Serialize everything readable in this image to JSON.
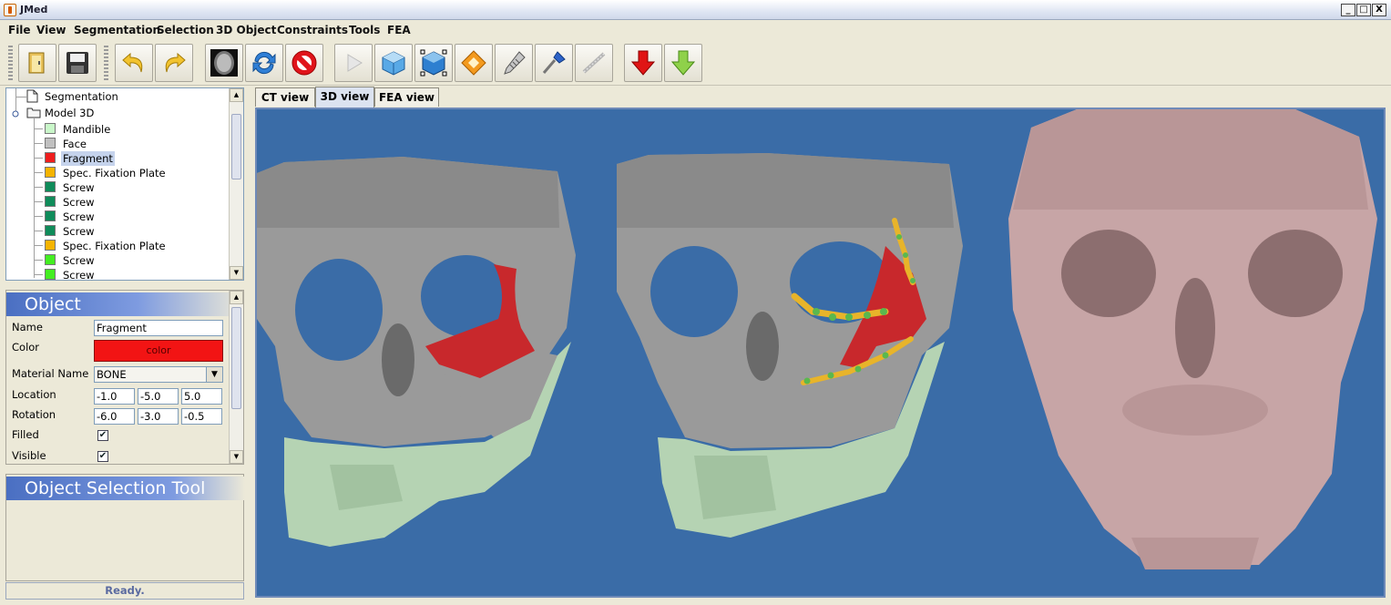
{
  "window": {
    "title": "JMed",
    "minimize": "_",
    "maximize": "□",
    "close": "X"
  },
  "menu": [
    "File",
    "View",
    "Segmentation",
    "Selection",
    "3D Object",
    "Constraints",
    "Tools",
    "FEA"
  ],
  "toolbar": {
    "buttons": [
      "open-icon",
      "save-icon",
      "undo-icon",
      "redo-icon",
      "ct-scan-icon",
      "refresh-icon",
      "stop-icon",
      "play-icon",
      "cube-icon",
      "cube-select-icon",
      "plate-orange-icon",
      "screw-icon",
      "screwdriver-icon",
      "plate-bar-icon",
      "import-down-red-icon",
      "export-down-green-icon"
    ]
  },
  "tree": {
    "items": [
      {
        "label": "Segmentation",
        "kind": "document",
        "level": 0
      },
      {
        "label": "Model 3D",
        "kind": "folder",
        "level": 0
      },
      {
        "label": "Mandible",
        "color": "#c9f7c9",
        "level": 1
      },
      {
        "label": "Face",
        "color": "#c0c0c0",
        "level": 1
      },
      {
        "label": "Fragment",
        "color": "#ef1e1e",
        "level": 1,
        "selected": true
      },
      {
        "label": "Spec. Fixation Plate",
        "color": "#f5b400",
        "level": 1
      },
      {
        "label": "Screw",
        "color": "#0f8c5a",
        "level": 1
      },
      {
        "label": "Screw",
        "color": "#0f8c5a",
        "level": 1
      },
      {
        "label": "Screw",
        "color": "#0f8c5a",
        "level": 1
      },
      {
        "label": "Screw",
        "color": "#0f8c5a",
        "level": 1
      },
      {
        "label": "Spec. Fixation Plate",
        "color": "#f5b400",
        "level": 1
      },
      {
        "label": "Screw",
        "color": "#44ee22",
        "level": 1
      },
      {
        "label": "Screw",
        "color": "#44ee22",
        "level": 1
      }
    ]
  },
  "object_panel": {
    "title": "Object",
    "name_label": "Name",
    "name_value": "Fragment",
    "color_label": "Color",
    "color_button": "color",
    "color_value": "#f21414",
    "material_label": "Material Name",
    "material_value": "BONE",
    "location_label": "Location",
    "location": [
      "-1.0",
      "-5.0",
      "5.0"
    ],
    "rotation_label": "Rotation",
    "rotation": [
      "-6.0",
      "-3.0",
      "-0.5"
    ],
    "filled_label": "Filled",
    "filled": true,
    "visible_label": "Visible",
    "visible": true
  },
  "selection_panel": {
    "title": "Object Selection Tool"
  },
  "status": "Ready.",
  "tabs": [
    {
      "label": "CT view",
      "active": false
    },
    {
      "label": "3D view",
      "active": true
    },
    {
      "label": "FEA view",
      "active": false
    }
  ],
  "viewport": {
    "background": "#3a6ca7",
    "skull_color": "#9a9a9a",
    "mandible_color": "#b5d3b3",
    "fragment_color": "#c8282c",
    "plate_color": "#e8b42a",
    "pink_skull_color": "#c7a5a6"
  }
}
